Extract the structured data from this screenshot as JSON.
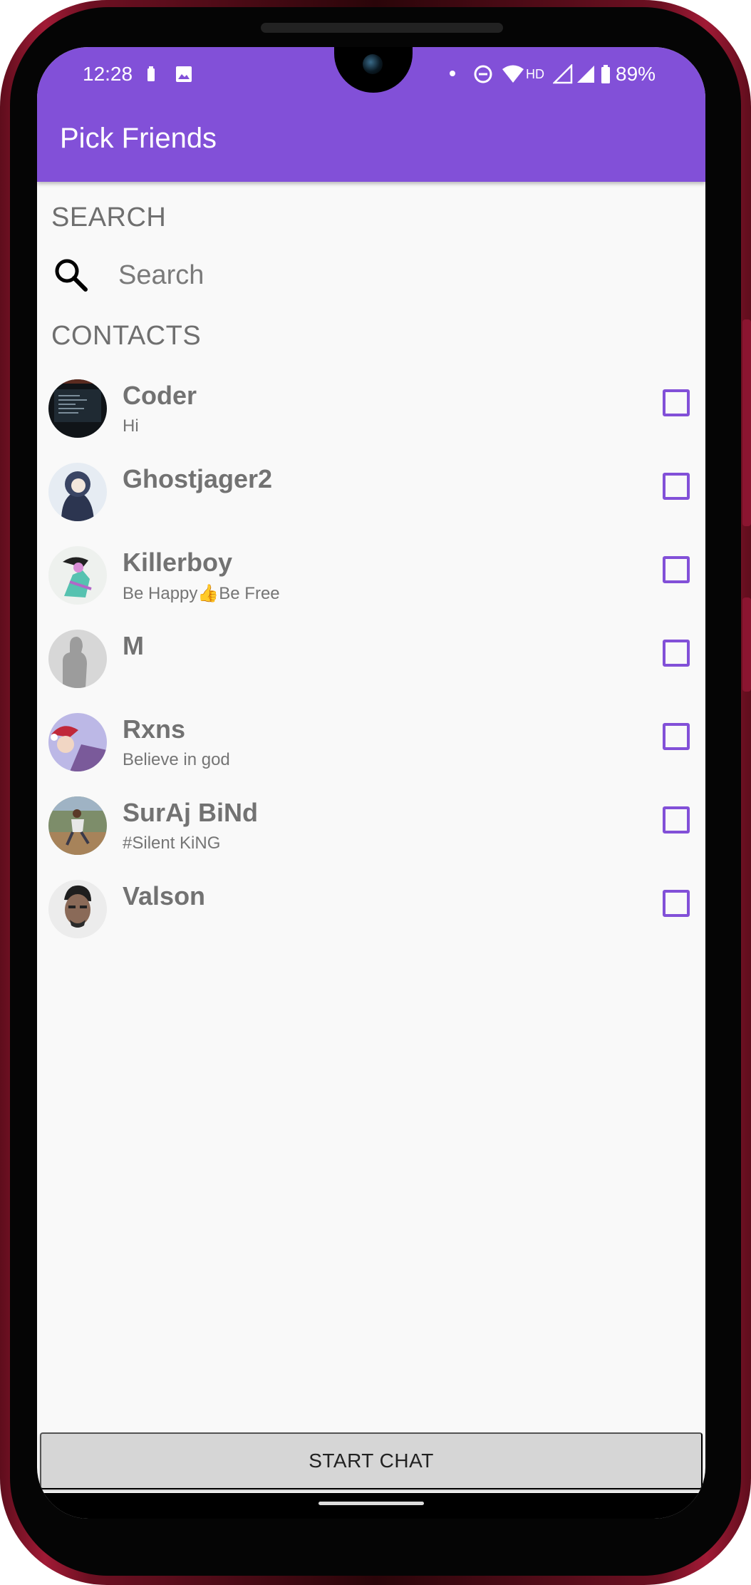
{
  "status_bar": {
    "time": "12:28",
    "network_label": "HD",
    "battery_percent": "89%",
    "icons": [
      "battery-saver-icon",
      "gallery-icon",
      "notification-dot-icon",
      "do-not-disturb-icon",
      "wifi-icon",
      "signal-icon",
      "signal-icon",
      "battery-icon"
    ]
  },
  "appbar": {
    "title": "Pick Friends"
  },
  "search": {
    "section_label": "SEARCH",
    "placeholder": "Search",
    "value": ""
  },
  "contacts": {
    "section_label": "CONTACTS",
    "items": [
      {
        "name": "Coder",
        "status": "Hi",
        "checked": false
      },
      {
        "name": "Ghostjager2",
        "status": "",
        "checked": false
      },
      {
        "name": "Killerboy",
        "status": "Be Happy👍Be Free",
        "checked": false
      },
      {
        "name": "M",
        "status": "",
        "checked": false
      },
      {
        "name": "Rxns",
        "status": "Believe in god",
        "checked": false
      },
      {
        "name": "SurAj BiNd",
        "status": "#Silent KiNG",
        "checked": false
      },
      {
        "name": "Valson",
        "status": "",
        "checked": false
      }
    ]
  },
  "footer": {
    "start_chat_label": "START CHAT"
  },
  "colors": {
    "accent": "#8250d8",
    "background": "#f9f9f9",
    "frame": "#a01a35"
  }
}
